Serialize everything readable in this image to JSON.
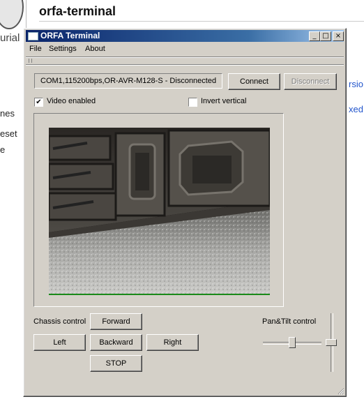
{
  "background_page": {
    "logo_text": "urial",
    "title": "orfa-terminal",
    "sidebar_fragments": [
      "nes",
      "eset",
      "e"
    ],
    "right_fragments": [
      "rsio",
      "xed"
    ]
  },
  "window": {
    "title": "ORFA Terminal",
    "buttons": {
      "minimize": "_",
      "maximize": "□",
      "close": "×"
    },
    "menu": [
      "File",
      "Settings",
      "About"
    ]
  },
  "connection": {
    "status": "COM1,115200bps,OR-AVR-M128-S - Disconnected",
    "connect_label": "Connect",
    "disconnect_label": "Disconnect"
  },
  "options": {
    "video_enabled_label": "Video enabled",
    "video_enabled": true,
    "invert_vertical_label": "Invert vertical",
    "invert_vertical": false
  },
  "chassis": {
    "label": "Chassis control",
    "forward": "Forward",
    "left": "Left",
    "backward": "Backward",
    "right": "Right",
    "stop": "STOP"
  },
  "pan_tilt": {
    "label": "Pan&Tilt control",
    "pan_value": 0.5,
    "tilt_value": 0.5
  },
  "colors": {
    "title_gradient_start": "#0a246a",
    "title_gradient_end": "#a6caf0",
    "window_face": "#d4d0c8",
    "disabled_text": "#808080"
  }
}
